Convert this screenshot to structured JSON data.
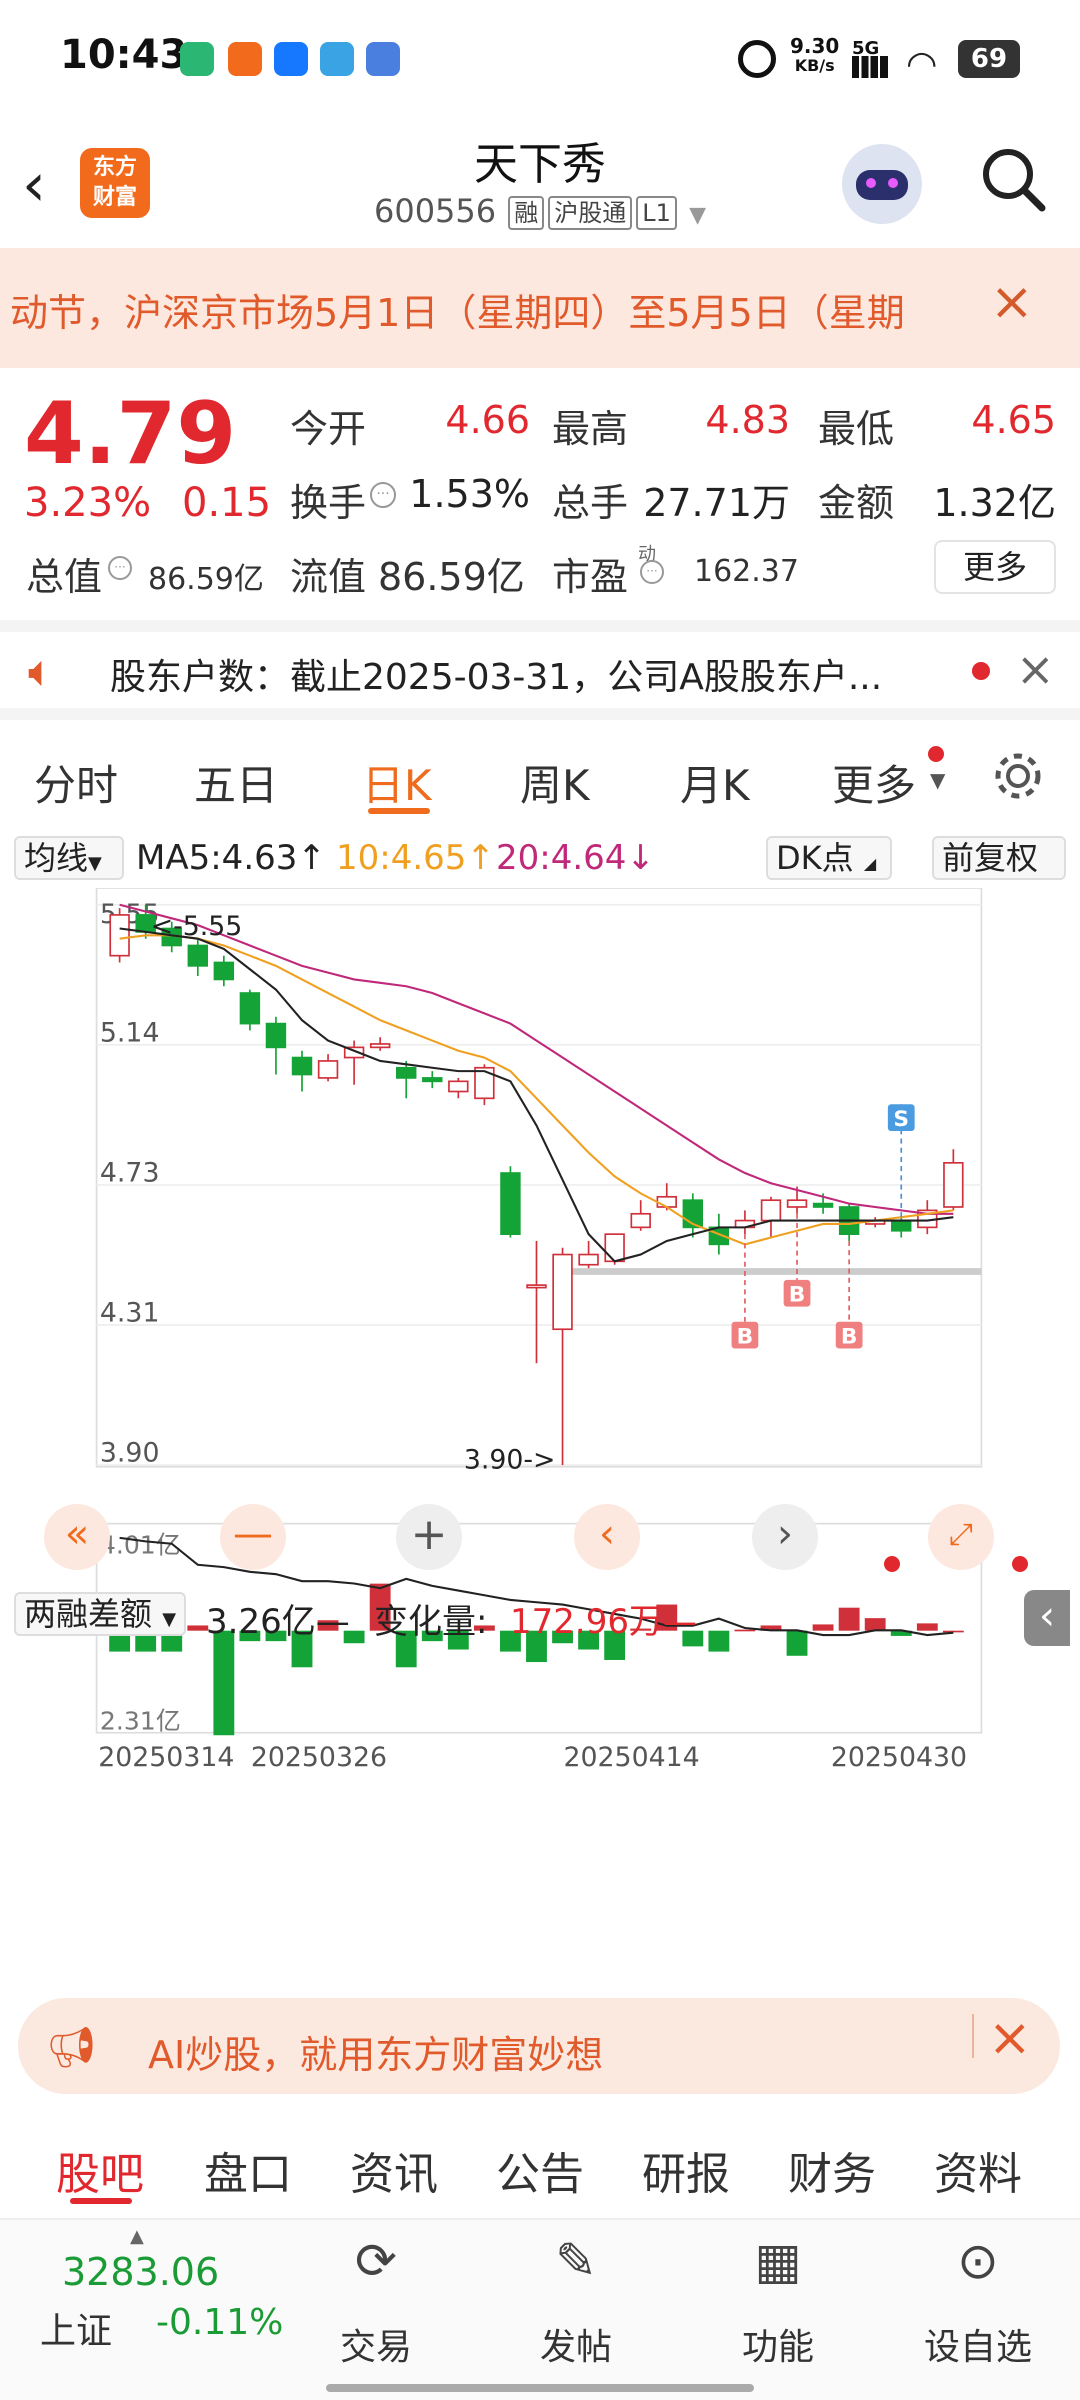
{
  "status": {
    "time": "10:43",
    "net_speed": "9.30",
    "net_unit": "KB/s",
    "signal": "5G",
    "battery": "69"
  },
  "header": {
    "logo_line1": "东方",
    "logo_line2": "财富",
    "title": "天下秀",
    "code": "600556",
    "tags": [
      "融",
      "沪股通",
      "L1"
    ]
  },
  "notice": {
    "text": "动节，沪深京市场5月1日（星期四）至5月5日（星期",
    "close": "×"
  },
  "quote": {
    "price": "4.79",
    "pct": "3.23%",
    "change": "0.15",
    "rows": [
      [
        {
          "l": "今开",
          "v": "4.66",
          "c": "r"
        },
        {
          "l": "最高",
          "v": "4.83",
          "c": "r"
        },
        {
          "l": "最低",
          "v": "4.65",
          "c": "r"
        }
      ],
      [
        {
          "l": "换手",
          "v": "1.53%",
          "c": "k"
        },
        {
          "l": "总手",
          "v": "27.71万",
          "c": "k"
        },
        {
          "l": "金额",
          "v": "1.32亿",
          "c": "k"
        }
      ]
    ],
    "total_value_label": "总值",
    "total_value": "86.59亿",
    "float_label": "流值",
    "float_value": "86.59亿",
    "pe_label": "市盈",
    "pe_sup": "动",
    "pe_value": "162.37",
    "more": "更多"
  },
  "holder": {
    "text": "股东户数：截止2025-03-31，公司A股股东户..."
  },
  "tabs": [
    "分时",
    "五日",
    "日K",
    "周K",
    "月K",
    "更多"
  ],
  "ma": {
    "selector": "均线",
    "ma5": "MA5:4.63↑",
    "ma10": "10:4.65↑",
    "ma20": "20:4.64↓",
    "dk": "DK点",
    "fq": "前复权"
  },
  "chart_data": {
    "type": "candlestick",
    "price_axis": {
      "ticks": [
        "5.55",
        "5.14",
        "4.73",
        "4.31",
        "3.90"
      ],
      "min": 3.9,
      "max": 5.55
    },
    "high_label": "<-5.55",
    "low_label": "3.90->",
    "candles": [
      [
        5.4,
        5.52,
        5.54,
        5.38
      ],
      [
        5.52,
        5.47,
        5.55,
        5.45
      ],
      [
        5.48,
        5.43,
        5.5,
        5.41
      ],
      [
        5.43,
        5.37,
        5.45,
        5.34
      ],
      [
        5.38,
        5.33,
        5.4,
        5.31
      ],
      [
        5.29,
        5.2,
        5.3,
        5.18
      ],
      [
        5.2,
        5.13,
        5.22,
        5.05
      ],
      [
        5.1,
        5.05,
        5.12,
        5.0
      ],
      [
        5.04,
        5.09,
        5.11,
        5.03
      ],
      [
        5.1,
        5.13,
        5.15,
        5.02
      ],
      [
        5.13,
        5.14,
        5.16,
        5.12
      ],
      [
        5.07,
        5.04,
        5.09,
        4.98
      ],
      [
        5.04,
        5.03,
        5.06,
        5.01
      ],
      [
        5.0,
        5.03,
        5.04,
        4.98
      ],
      [
        4.98,
        5.07,
        5.08,
        4.96
      ],
      [
        4.76,
        4.58,
        4.78,
        4.57
      ],
      [
        4.43,
        4.43,
        4.56,
        4.2
      ],
      [
        4.3,
        4.52,
        4.54,
        3.9
      ],
      [
        4.49,
        4.52,
        4.56,
        4.48
      ],
      [
        4.5,
        4.58,
        4.58,
        4.49
      ],
      [
        4.6,
        4.64,
        4.68,
        4.59
      ],
      [
        4.66,
        4.69,
        4.73,
        4.65
      ],
      [
        4.68,
        4.6,
        4.7,
        4.57
      ],
      [
        4.6,
        4.55,
        4.64,
        4.52
      ],
      [
        4.6,
        4.62,
        4.65,
        4.58
      ],
      [
        4.62,
        4.68,
        4.69,
        4.57
      ],
      [
        4.66,
        4.68,
        4.72,
        4.64
      ],
      [
        4.67,
        4.66,
        4.7,
        4.64
      ],
      [
        4.66,
        4.58,
        4.67,
        4.56
      ],
      [
        4.61,
        4.62,
        4.63,
        4.6
      ],
      [
        4.62,
        4.59,
        4.63,
        4.57
      ],
      [
        4.6,
        4.65,
        4.68,
        4.58
      ],
      [
        4.66,
        4.79,
        4.83,
        4.65
      ]
    ],
    "ma5": [
      5.48,
      5.47,
      5.46,
      5.45,
      5.42,
      5.36,
      5.3,
      5.21,
      5.15,
      5.12,
      5.09,
      5.08,
      5.07,
      5.06,
      5.06,
      5.03,
      4.9,
      4.74,
      4.58,
      4.5,
      4.52,
      4.56,
      4.58,
      4.6,
      4.6,
      4.62,
      4.62,
      4.62,
      4.62,
      4.62,
      4.62,
      4.62,
      4.63
    ],
    "ma10": [
      5.45,
      5.46,
      5.46,
      5.45,
      5.43,
      5.4,
      5.37,
      5.33,
      5.29,
      5.25,
      5.21,
      5.18,
      5.15,
      5.12,
      5.1,
      5.06,
      4.98,
      4.9,
      4.82,
      4.75,
      4.7,
      4.66,
      4.61,
      4.58,
      4.55,
      4.57,
      4.59,
      4.61,
      4.61,
      4.62,
      4.63,
      4.64,
      4.65
    ],
    "ma20": [
      5.55,
      5.53,
      5.51,
      5.49,
      5.46,
      5.43,
      5.4,
      5.37,
      5.35,
      5.33,
      5.32,
      5.31,
      5.29,
      5.26,
      5.23,
      5.2,
      5.15,
      5.1,
      5.05,
      5.0,
      4.95,
      4.9,
      4.85,
      4.8,
      4.76,
      4.73,
      4.71,
      4.69,
      4.67,
      4.66,
      4.65,
      4.64,
      4.64
    ],
    "signals": [
      {
        "i": 24,
        "t": "B"
      },
      {
        "i": 26,
        "t": "B"
      },
      {
        "i": 28,
        "t": "B"
      },
      {
        "i": 30,
        "t": "S"
      }
    ],
    "sub_label": "两融差额",
    "sub_value": "3.26亿—",
    "sub_change_label": "变化量:",
    "sub_change": "172.96万—",
    "sub_axis": [
      "4.01亿",
      "2.31亿"
    ],
    "sub_bars": [
      -0.2,
      -0.2,
      -0.2,
      0.05,
      -1.0,
      -0.1,
      -0.1,
      -0.35,
      0.1,
      -0.12,
      0.45,
      -0.35,
      -0.1,
      -0.18,
      0.05,
      -0.2,
      -0.3,
      -0.12,
      -0.18,
      -0.28,
      0.02,
      0.25,
      -0.15,
      -0.2,
      0.01,
      0.05,
      -0.24,
      0.06,
      0.22,
      0.12,
      -0.05,
      0.07,
      0.0
    ],
    "sub_line": [
      0.95,
      0.92,
      0.9,
      0.72,
      0.7,
      0.66,
      0.64,
      0.58,
      0.58,
      0.56,
      0.52,
      0.6,
      0.54,
      0.5,
      0.46,
      0.42,
      0.4,
      0.38,
      0.34,
      0.3,
      0.26,
      0.2,
      0.2,
      0.26,
      0.18,
      0.16,
      0.16,
      0.12,
      0.12,
      0.16,
      0.16,
      0.12,
      0.14
    ],
    "dates": [
      "20250314",
      "20250326",
      "20250414",
      "20250430"
    ]
  },
  "controls": {
    "zoom_out": "—",
    "zoom_in": "+"
  },
  "bottom_notice": {
    "text": "AI炒股，就用东方财富妙想",
    "close": "×"
  },
  "footer_tabs": [
    "股吧",
    "盘口",
    "资讯",
    "公告",
    "研报",
    "财务",
    "资料"
  ],
  "nav": {
    "index_value": "3283.06",
    "index_name": "上证",
    "index_change": "-0.11%",
    "items": [
      {
        "icon": "exchange-yen-icon",
        "label": "交易"
      },
      {
        "icon": "edit-post-icon",
        "label": "发帖"
      },
      {
        "icon": "grid-icon",
        "label": "功能"
      },
      {
        "icon": "more-dots-icon",
        "label": "设自选"
      }
    ]
  }
}
